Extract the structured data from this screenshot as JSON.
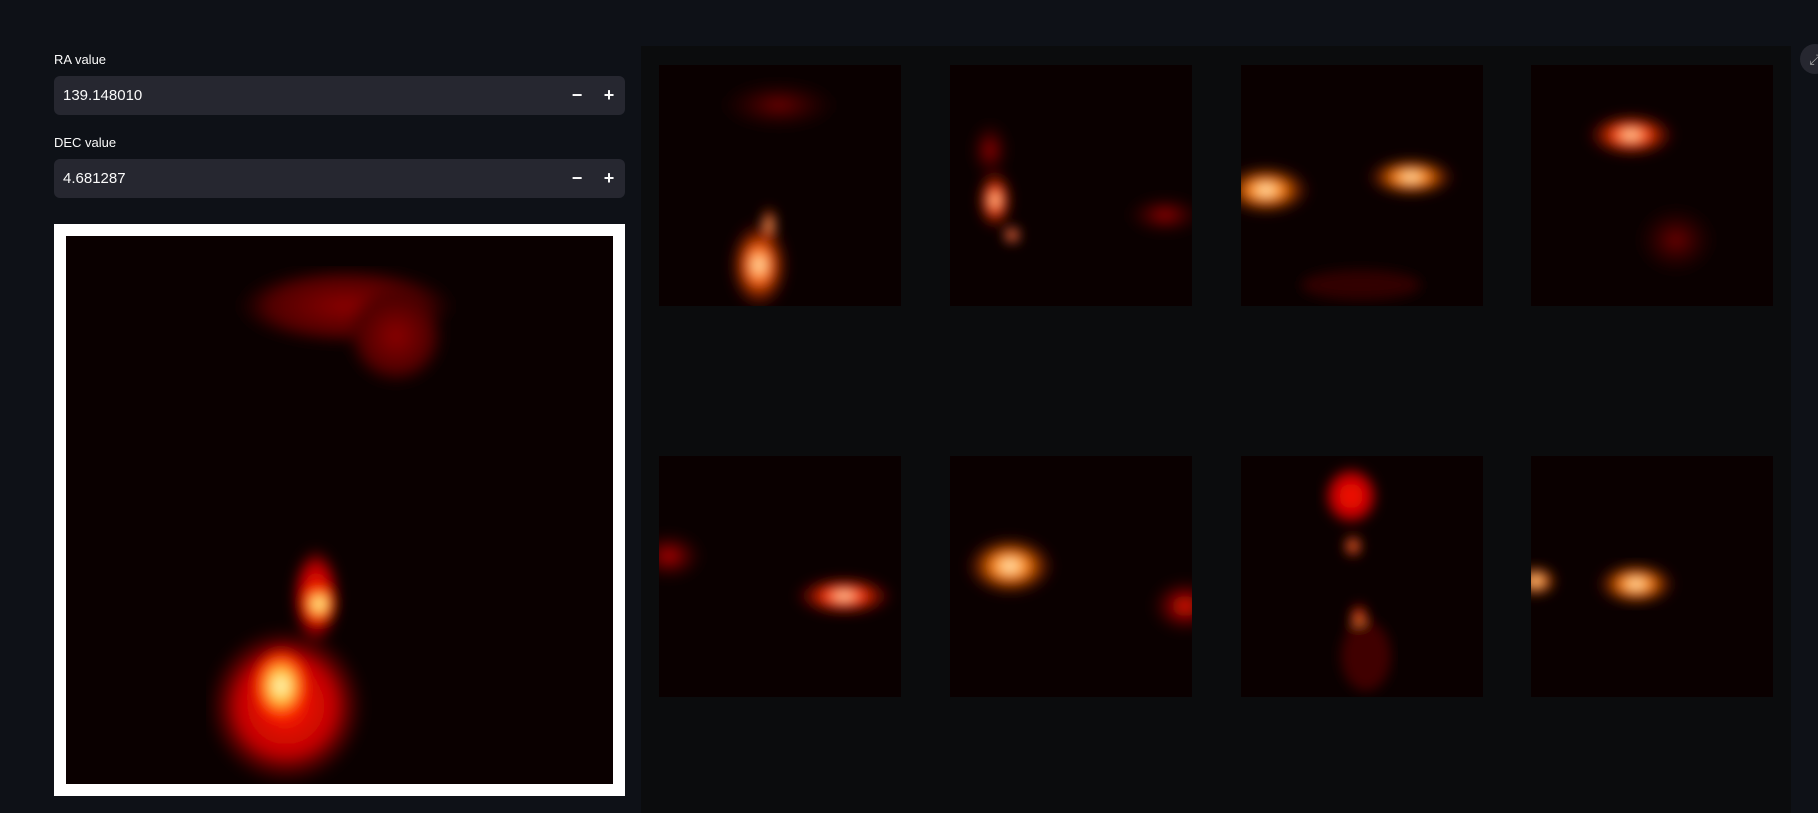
{
  "inputs": {
    "ra": {
      "label": "RA value",
      "value": "139.148010",
      "decrement": "−",
      "increment": "+"
    },
    "dec": {
      "label": "DEC value",
      "value": "4.681287",
      "decrement": "−",
      "increment": "+"
    }
  },
  "colors": {
    "background": "#0e1117",
    "input_bg": "#262730",
    "gallery_bg": "#0b0c0d",
    "image_bg": "#0a0000",
    "heat_red": "#ff1a00",
    "heat_yellow": "#ffff80"
  },
  "gallery": {
    "rows": 2,
    "columns": 4,
    "thumbnails": [
      "similar-image-1",
      "similar-image-2",
      "similar-image-3",
      "similar-image-4",
      "similar-image-5",
      "similar-image-6",
      "similar-image-7",
      "similar-image-8"
    ]
  },
  "icons": {
    "corner": "expand-icon"
  }
}
